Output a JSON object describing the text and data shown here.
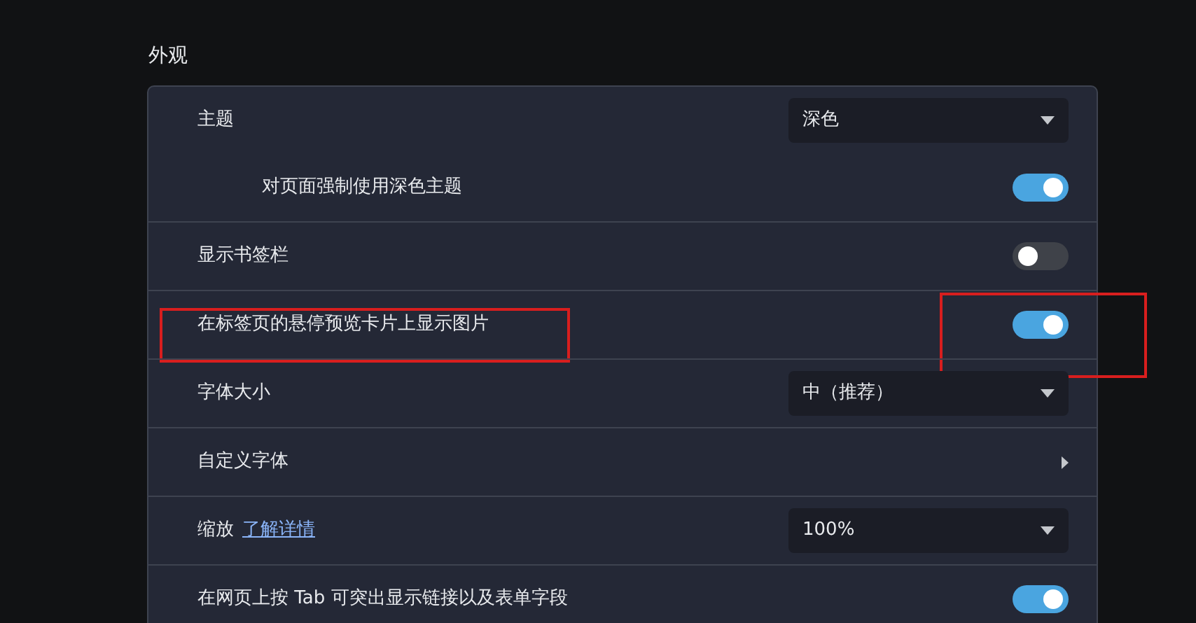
{
  "section": {
    "title": "外观"
  },
  "rows": [
    {
      "kind": "select",
      "label": "主题",
      "value": "深色",
      "children": [
        {
          "kind": "toggle",
          "label": "对页面强制使用深色主题",
          "on": true
        }
      ]
    },
    {
      "kind": "toggle",
      "label": "显示书签栏",
      "on": false
    },
    {
      "kind": "toggle",
      "label": "在标签页的悬停预览卡片上显示图片",
      "on": true,
      "highlighted": true
    },
    {
      "kind": "select",
      "label": "字体大小",
      "value": "中（推荐）"
    },
    {
      "kind": "submenu",
      "label": "自定义字体"
    },
    {
      "kind": "select",
      "label": "缩放",
      "link": "了解详情",
      "value": "100%"
    },
    {
      "kind": "toggle",
      "label": "在网页上按 Tab 可突出显示链接以及表单字段",
      "on": true
    }
  ]
}
